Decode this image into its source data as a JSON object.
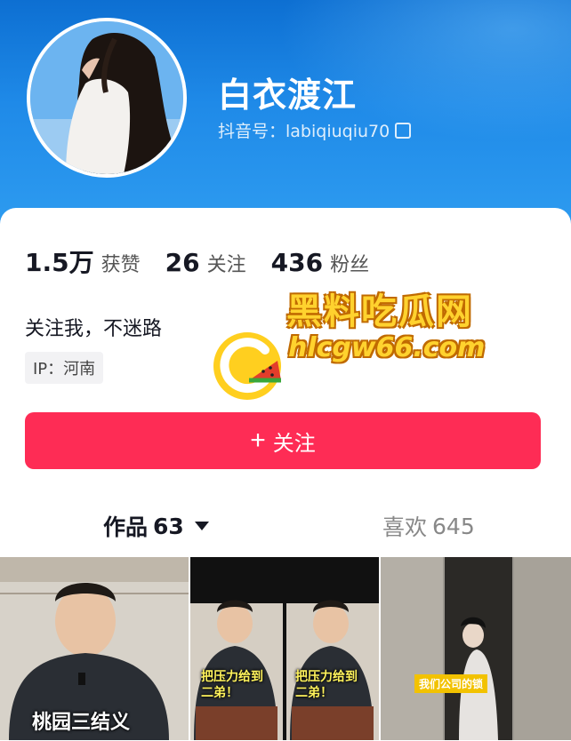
{
  "profile": {
    "name": "白衣渡江",
    "douyin_id": "抖音号：labiqiuqiu70"
  },
  "stats": [
    {
      "num": "1.5万",
      "label": "获赞"
    },
    {
      "num": "26",
      "label": "关注"
    },
    {
      "num": "436",
      "label": "粉丝"
    }
  ],
  "bio": "关注我，不迷路",
  "ip": "IP：河南",
  "follow_button": {
    "plus": "+",
    "label": "关注"
  },
  "tabs": {
    "works": {
      "label": "作品",
      "count": "63"
    },
    "likes": {
      "label": "喜欢",
      "count": "645"
    }
  },
  "videos": [
    {
      "caption": "桃园三结义"
    },
    {
      "caption_left": "把压力给到\n二弟！",
      "caption_right": "把压力给到\n二弟！"
    },
    {
      "caption": "我们公司的锁"
    }
  ],
  "watermark": {
    "line1": "黑料吃瓜网",
    "line2": "hlcgw66.com"
  },
  "colors": {
    "header": "#1f8ae8",
    "follow": "#fe2c55",
    "watermark": "#ffd22e"
  }
}
